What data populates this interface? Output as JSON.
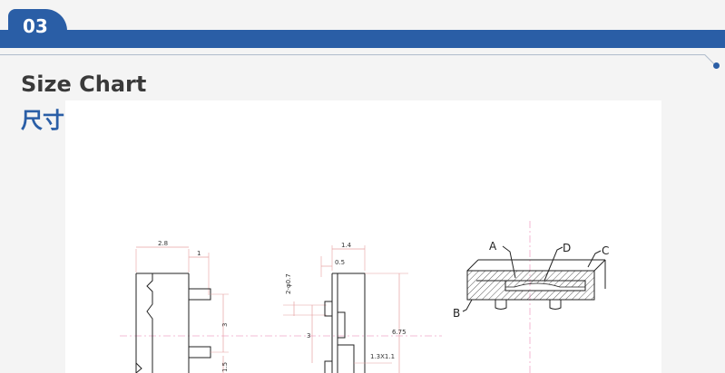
{
  "section": {
    "number": "03"
  },
  "heading": {
    "english": "Size Chart",
    "chinese": "尺寸图"
  },
  "drawing": {
    "dims": {
      "d_2_8": "2.8",
      "d_1": "1",
      "d_3_left": "3",
      "d_1_5": "1.5",
      "d_1_4": "1.4",
      "d_0_5": "0.5",
      "d_2_phi": "2-φ0.7",
      "d_3_mid": "3",
      "d_6_75": "6.75",
      "d_1_3": "1.3X1.1"
    },
    "part_labels": {
      "a": "A",
      "b": "B",
      "c": "C",
      "d": "D"
    }
  }
}
